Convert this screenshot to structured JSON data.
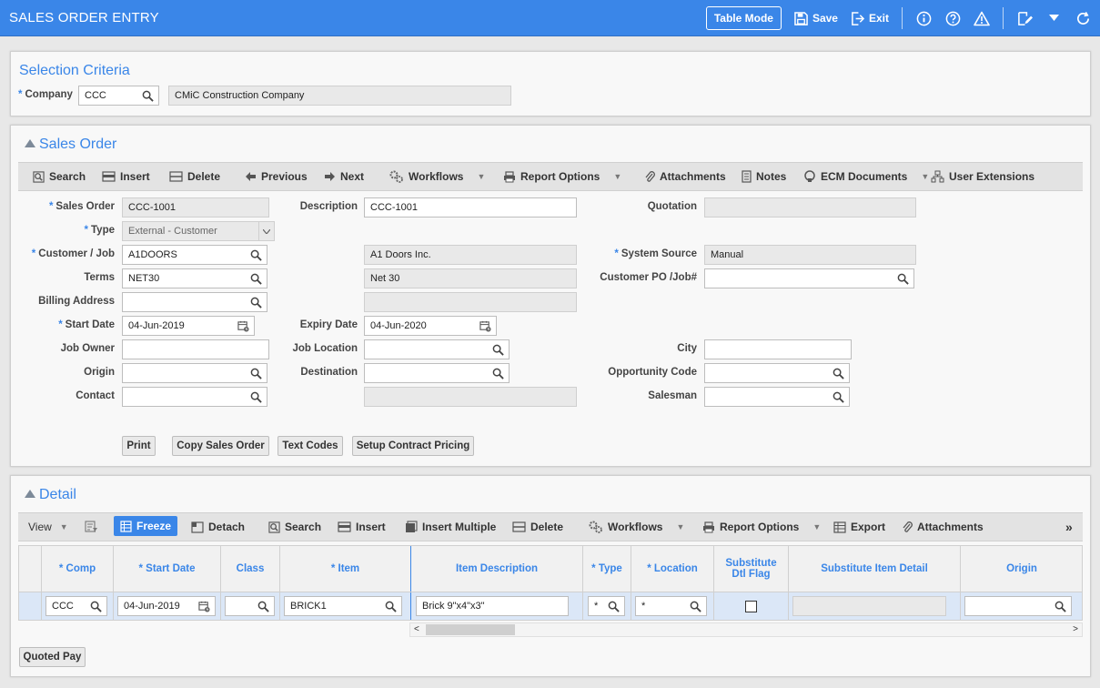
{
  "header": {
    "title": "SALES ORDER ENTRY",
    "table_mode": "Table Mode",
    "save": "Save",
    "exit": "Exit"
  },
  "selection": {
    "title": "Selection Criteria",
    "company_label": "Company",
    "company_value": "CCC",
    "company_name": "CMiC Construction Company"
  },
  "sales_order": {
    "title": "Sales Order",
    "toolbar": {
      "search": "Search",
      "insert": "Insert",
      "delete": "Delete",
      "previous": "Previous",
      "next": "Next",
      "workflows": "Workflows",
      "report_options": "Report Options",
      "attachments": "Attachments",
      "notes": "Notes",
      "ecm_documents": "ECM Documents",
      "user_extensions": "User Extensions"
    },
    "labels": {
      "sales_order": "Sales Order",
      "type": "Type",
      "customer_job": "Customer / Job",
      "terms": "Terms",
      "billing_address": "Billing Address",
      "start_date": "Start Date",
      "job_owner": "Job Owner",
      "origin": "Origin",
      "contact": "Contact",
      "description": "Description",
      "expiry_date": "Expiry Date",
      "job_location": "Job Location",
      "destination": "Destination",
      "quotation": "Quotation",
      "system_source": "System Source",
      "customer_po": "Customer PO /Job#",
      "city": "City",
      "opportunity_code": "Opportunity Code",
      "salesman": "Salesman"
    },
    "values": {
      "sales_order": "CCC-1001",
      "type": "External - Customer",
      "customer_job": "A1DOORS",
      "customer_name": "A1 Doors Inc.",
      "terms": "NET30",
      "terms_desc": "Net 30",
      "start_date": "04-Jun-2019",
      "description": "CCC-1001",
      "expiry_date": "04-Jun-2020",
      "system_source": "Manual"
    },
    "buttons": {
      "print": "Print",
      "copy_sales_order": "Copy Sales Order",
      "text_codes": "Text Codes",
      "setup_contract_pricing": "Setup Contract Pricing"
    }
  },
  "detail": {
    "title": "Detail",
    "toolbar": {
      "view": "View",
      "freeze": "Freeze",
      "detach": "Detach",
      "search": "Search",
      "insert": "Insert",
      "insert_multiple": "Insert Multiple",
      "delete": "Delete",
      "workflows": "Workflows",
      "report_options": "Report Options",
      "export": "Export",
      "attachments": "Attachments"
    },
    "columns": {
      "comp": "Comp",
      "start_date": "Start Date",
      "class": "Class",
      "item": "Item",
      "item_description": "Item Description",
      "type": "Type",
      "location": "Location",
      "substitute_dtl_flag_1": "Substitute",
      "substitute_dtl_flag_2": "Dtl Flag",
      "substitute_item_detail": "Substitute Item Detail",
      "origin": "Origin"
    },
    "row": {
      "comp": "CCC",
      "start_date": "04-Jun-2019",
      "class": "",
      "item": "BRICK1",
      "item_description": "Brick 9\"x4\"x3\"",
      "type": "*",
      "location": "*"
    },
    "quoted_pay": "Quoted Pay"
  }
}
